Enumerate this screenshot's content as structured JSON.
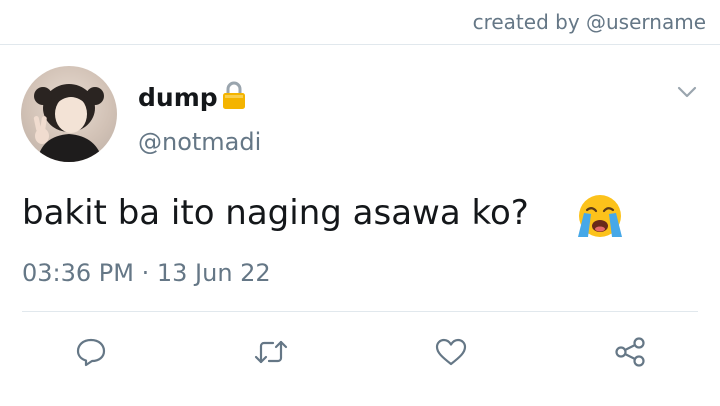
{
  "credit": "created by @username",
  "tweet": {
    "display_name": "dump",
    "handle": "@notmadi",
    "text": "bakit ba ito naging asawa ko?",
    "timestamp": "03:36 PM · 13 Jun 22"
  },
  "icons": {
    "lock": "lock-icon",
    "chevron": "chevron-down-icon",
    "emoji": "loudly-crying-face-emoji",
    "reply": "reply-icon",
    "retweet": "retweet-icon",
    "like": "heart-icon",
    "share": "share-icon"
  },
  "colors": {
    "secondary_text": "#657786",
    "primary_text": "#14171a",
    "divider": "#e1e8ed",
    "lock": "#f4b400"
  }
}
